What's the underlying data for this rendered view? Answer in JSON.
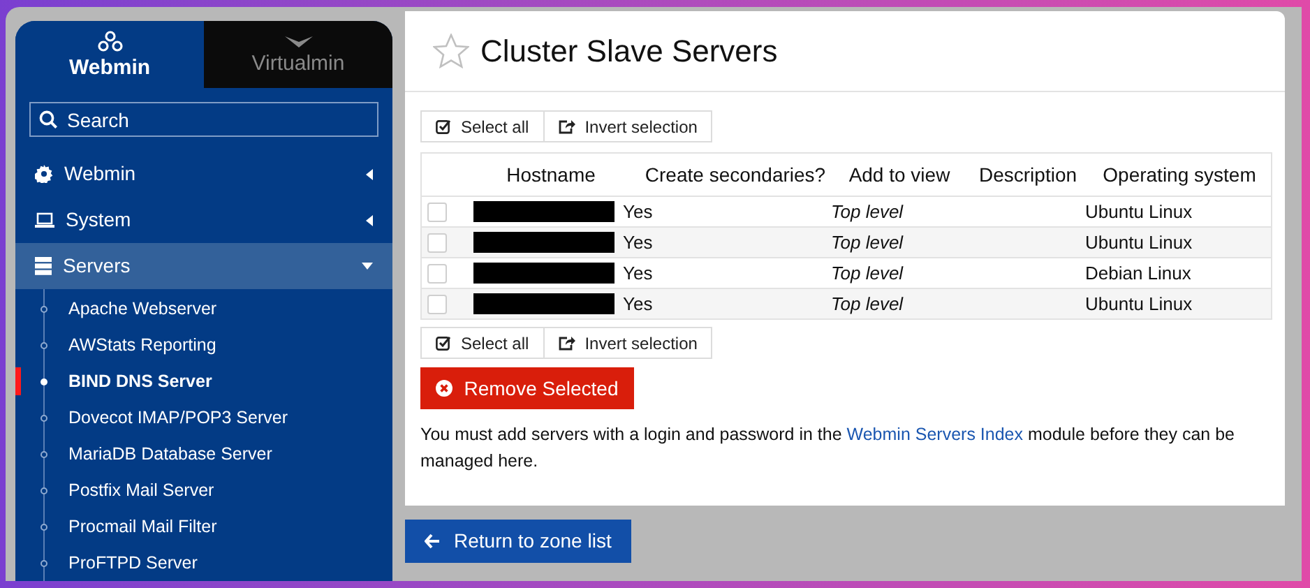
{
  "sidebar": {
    "tabs": [
      {
        "label": "Webmin",
        "selected": true
      },
      {
        "label": "Virtualmin",
        "selected": false
      }
    ],
    "search": {
      "placeholder": "Search"
    },
    "sections": [
      {
        "label": "Webmin",
        "expanded": false
      },
      {
        "label": "System",
        "expanded": false
      },
      {
        "label": "Servers",
        "expanded": true,
        "children": [
          {
            "label": "Apache Webserver",
            "selected": false
          },
          {
            "label": "AWStats Reporting",
            "selected": false
          },
          {
            "label": "BIND DNS Server",
            "selected": true
          },
          {
            "label": "Dovecot IMAP/POP3 Server",
            "selected": false
          },
          {
            "label": "MariaDB Database Server",
            "selected": false
          },
          {
            "label": "Postfix Mail Server",
            "selected": false
          },
          {
            "label": "Procmail Mail Filter",
            "selected": false
          },
          {
            "label": "ProFTPD Server",
            "selected": false
          }
        ]
      }
    ]
  },
  "page": {
    "title": "Cluster Slave Servers",
    "favorite": false,
    "select_buttons": [
      "Select all",
      "Invert selection"
    ],
    "table": {
      "columns": [
        "Hostname",
        "Create secondaries?",
        "Add to view",
        "Description",
        "Operating system"
      ],
      "rows": [
        {
          "checked": false,
          "hostname_redacted": true,
          "create_secondaries": "Yes",
          "add_to_view": "Top level",
          "os": "Ubuntu Linux"
        },
        {
          "checked": false,
          "hostname_redacted": true,
          "create_secondaries": "Yes",
          "add_to_view": "Top level",
          "os": "Ubuntu Linux"
        },
        {
          "checked": false,
          "hostname_redacted": true,
          "create_secondaries": "Yes",
          "add_to_view": "Top level",
          "os": "Debian Linux"
        },
        {
          "checked": false,
          "hostname_redacted": true,
          "create_secondaries": "Yes",
          "add_to_view": "Top level",
          "os": "Ubuntu Linux"
        }
      ]
    },
    "select_buttons_bottom": [
      "Select all",
      "Invert selection"
    ],
    "remove_button": "Remove Selected",
    "note": {
      "before": "You must add servers with a login and password in the",
      "link": "Webmin Servers Index",
      "after": "module before they can be managed here."
    }
  },
  "return_button": "Return to zone list"
}
